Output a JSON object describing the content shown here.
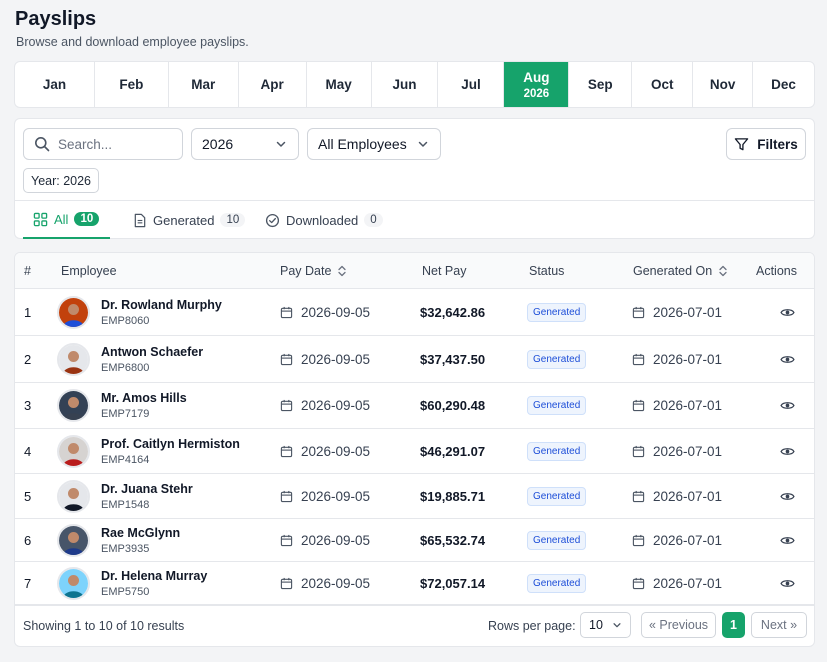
{
  "page": {
    "title": "Payslips",
    "subtitle": "Browse and download employee payslips."
  },
  "months": [
    {
      "label": "Jan",
      "active": false
    },
    {
      "label": "Feb",
      "active": false
    },
    {
      "label": "Mar",
      "active": false
    },
    {
      "label": "Apr",
      "active": false
    },
    {
      "label": "May",
      "active": false
    },
    {
      "label": "Jun",
      "active": false
    },
    {
      "label": "Jul",
      "active": false
    },
    {
      "label": "Aug",
      "active": true,
      "year": "2026"
    },
    {
      "label": "Sep",
      "active": false
    },
    {
      "label": "Oct",
      "active": false
    },
    {
      "label": "Nov",
      "active": false
    },
    {
      "label": "Dec",
      "active": false
    }
  ],
  "filters": {
    "search_placeholder": "Search...",
    "year_value": "2026",
    "employee_value": "All Employees",
    "filters_label": "Filters",
    "active_chip": "Year: 2026"
  },
  "tabs": [
    {
      "label": "All",
      "count": "10",
      "icon": "grid-icon",
      "active": true
    },
    {
      "label": "Generated",
      "count": "10",
      "icon": "document-icon",
      "active": false
    },
    {
      "label": "Downloaded",
      "count": "0",
      "icon": "check-circle-icon",
      "active": false
    }
  ],
  "table": {
    "headers": {
      "num": "#",
      "employee": "Employee",
      "pay_date": "Pay Date",
      "net_pay": "Net Pay",
      "status": "Status",
      "generated_on": "Generated On",
      "actions": "Actions"
    },
    "rows": [
      {
        "num": "1",
        "name": "Dr. Rowland Murphy",
        "id": "EMP8060",
        "pay_date": "2026-09-05",
        "net_pay": "$32,642.86",
        "status": "Generated",
        "generated_on": "2026-07-01"
      },
      {
        "num": "2",
        "name": "Antwon Schaefer",
        "id": "EMP6800",
        "pay_date": "2026-09-05",
        "net_pay": "$37,437.50",
        "status": "Generated",
        "generated_on": "2026-07-01"
      },
      {
        "num": "3",
        "name": "Mr. Amos Hills",
        "id": "EMP7179",
        "pay_date": "2026-09-05",
        "net_pay": "$60,290.48",
        "status": "Generated",
        "generated_on": "2026-07-01"
      },
      {
        "num": "4",
        "name": "Prof. Caitlyn Hermiston",
        "id": "EMP4164",
        "pay_date": "2026-09-05",
        "net_pay": "$46,291.07",
        "status": "Generated",
        "generated_on": "2026-07-01"
      },
      {
        "num": "5",
        "name": "Dr. Juana Stehr",
        "id": "EMP1548",
        "pay_date": "2026-09-05",
        "net_pay": "$19,885.71",
        "status": "Generated",
        "generated_on": "2026-07-01"
      },
      {
        "num": "6",
        "name": "Rae McGlynn",
        "id": "EMP3935",
        "pay_date": "2026-09-05",
        "net_pay": "$65,532.74",
        "status": "Generated",
        "generated_on": "2026-07-01"
      },
      {
        "num": "7",
        "name": "Dr. Helena Murray",
        "id": "EMP5750",
        "pay_date": "2026-09-05",
        "net_pay": "$72,057.14",
        "status": "Generated",
        "generated_on": "2026-07-01"
      }
    ]
  },
  "footer": {
    "showing": "Showing 1 to 10 of 10 results",
    "rows_per_page_label": "Rows per page:",
    "rows_per_page_value": "10",
    "previous": "« Previous",
    "current_page": "1",
    "next": "Next »"
  },
  "colors": {
    "accent": "#16a36b",
    "badge_text": "#1d4ed8",
    "badge_bg": "#eef4fd"
  }
}
